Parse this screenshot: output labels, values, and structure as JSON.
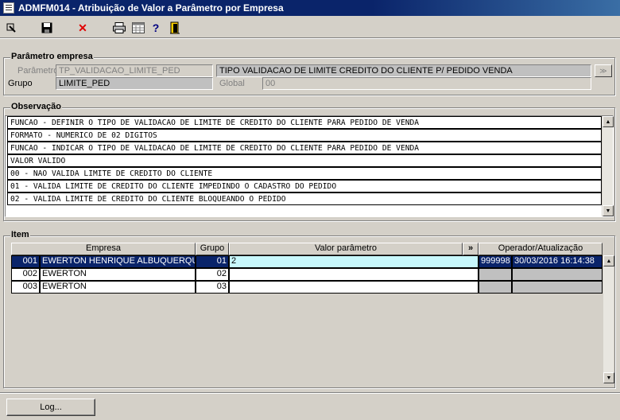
{
  "window": {
    "title": "ADMFM014 - Atribuição de Valor a Parâmetro por Empresa"
  },
  "toolbar": {
    "buttons": [
      {
        "name": "enter-query-icon",
        "glyph": "⇲"
      },
      {
        "name": "save-icon",
        "glyph": "💾"
      },
      {
        "name": "delete-icon",
        "glyph": "✕"
      },
      {
        "name": "print-icon",
        "glyph": "⎙"
      },
      {
        "name": "calendar-icon",
        "glyph": "▦"
      },
      {
        "name": "help-icon",
        "glyph": "?"
      },
      {
        "name": "exit-icon",
        "glyph": "⇥"
      }
    ]
  },
  "parametro_empresa": {
    "title": "Parâmetro empresa",
    "parametro_label": "Parâmetro",
    "parametro_value": "TP_VALIDACAO_LIMITE_PED",
    "parametro_desc": "TIPO VALIDACAO DE LIMITE CREDITO DO CLIENTE P/ PEDIDO VENDA",
    "grupo_label": "Grupo",
    "grupo_value": "LIMITE_PED",
    "global_label": "Global",
    "global_value": "00",
    "lov_label": "≫"
  },
  "observacao": {
    "title": "Observação",
    "lines": [
      "FUNCAO - DEFINIR O TIPO DE VALIDACAO DE LIMITE DE CREDITO DO CLIENTE PARA PEDIDO DE VENDA",
      "FORMATO - NUMERICO DE 02 DIGITOS",
      "FUNCAO - INDICAR O TIPO DE VALIDACAO DE LIMITE DE CREDITO DO CLIENTE PARA PEDIDO DE VENDA",
      "VALOR VALIDO",
      "00 - NAO VALIDA LIMITE DE CREDITO DO CLIENTE",
      "01 - VALIDA LIMITE DE CREDITO DO CLIENTE IMPEDINDO O CADASTRO DO PEDIDO",
      "02 - VALIDA LIMITE DE CREDITO DO CLIENTE BLOQUEANDO O PEDIDO"
    ]
  },
  "item": {
    "title": "Item",
    "headers": {
      "empresa": "Empresa",
      "grupo": "Grupo",
      "valor": "Valor parâmetro",
      "expand": "»",
      "operador": "Operador/Atualização"
    },
    "rows": [
      {
        "code": "001",
        "empresa": "EWERTON HENRIQUE ALBUQUERQUE D",
        "grupo": "01",
        "valor": "2",
        "operador": "999998",
        "data": "30/03/2016 16:14:38"
      },
      {
        "code": "002",
        "empresa": "EWERTON",
        "grupo": "02",
        "valor": "",
        "operador": "",
        "data": ""
      },
      {
        "code": "003",
        "empresa": "EWERTON",
        "grupo": "03",
        "valor": "",
        "operador": "",
        "data": ""
      }
    ]
  },
  "footer": {
    "log_label": "Log..."
  },
  "colors": {
    "title_bar": "#0a246a",
    "selected_row": "#0a246a",
    "current_cell": "#c8f8fc",
    "window_bg": "#d4d0c8"
  }
}
